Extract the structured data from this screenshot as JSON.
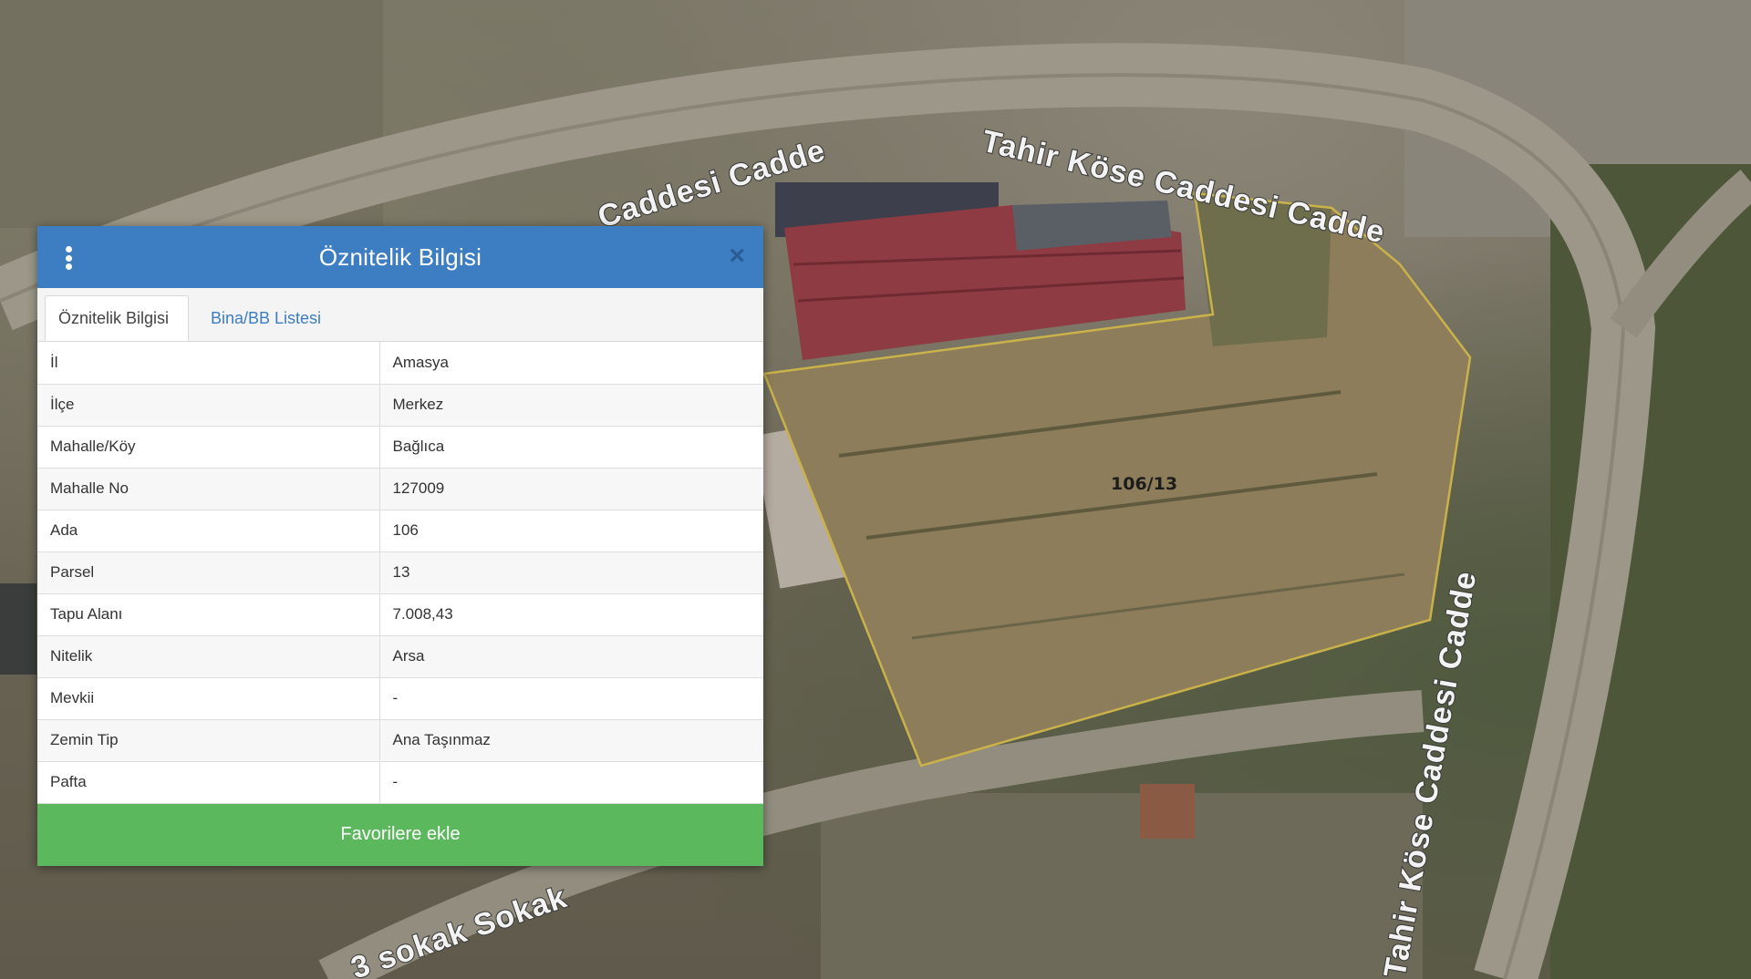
{
  "map": {
    "road_labels": {
      "top_left": "Caddesi Cadde",
      "top_right": "Tahir Köse Caddesi Cadde",
      "right_vertical": "Tahir Köse Caddesi Cadde",
      "bottom": "3 sokak Sokak"
    },
    "parcel_label": "106/13",
    "parcel_outline_color": "#c9b24a"
  },
  "panel": {
    "title": "Öznitelik Bilgisi",
    "header_color": "#3d7dc1",
    "menu_icon": "kebab-menu-icon",
    "close_icon": "close-icon",
    "close_glyph": "×",
    "tabs": [
      {
        "label": "Öznitelik Bilgisi",
        "active": true
      },
      {
        "label": "Bina/BB Listesi",
        "active": false
      }
    ],
    "rows": [
      {
        "key": "İl",
        "value": "Amasya"
      },
      {
        "key": "İlçe",
        "value": "Merkez"
      },
      {
        "key": "Mahalle/Köy",
        "value": "Bağlıca"
      },
      {
        "key": "Mahalle No",
        "value": "127009"
      },
      {
        "key": "Ada",
        "value": "106"
      },
      {
        "key": "Parsel",
        "value": "13"
      },
      {
        "key": "Tapu Alanı",
        "value": "7.008,43"
      },
      {
        "key": "Nitelik",
        "value": "Arsa"
      },
      {
        "key": "Mevkii",
        "value": "-"
      },
      {
        "key": "Zemin Tip",
        "value": "Ana Taşınmaz"
      },
      {
        "key": "Pafta",
        "value": "-"
      }
    ],
    "favorite_button": "Favorilere ekle",
    "favorite_color": "#5cb85c"
  }
}
